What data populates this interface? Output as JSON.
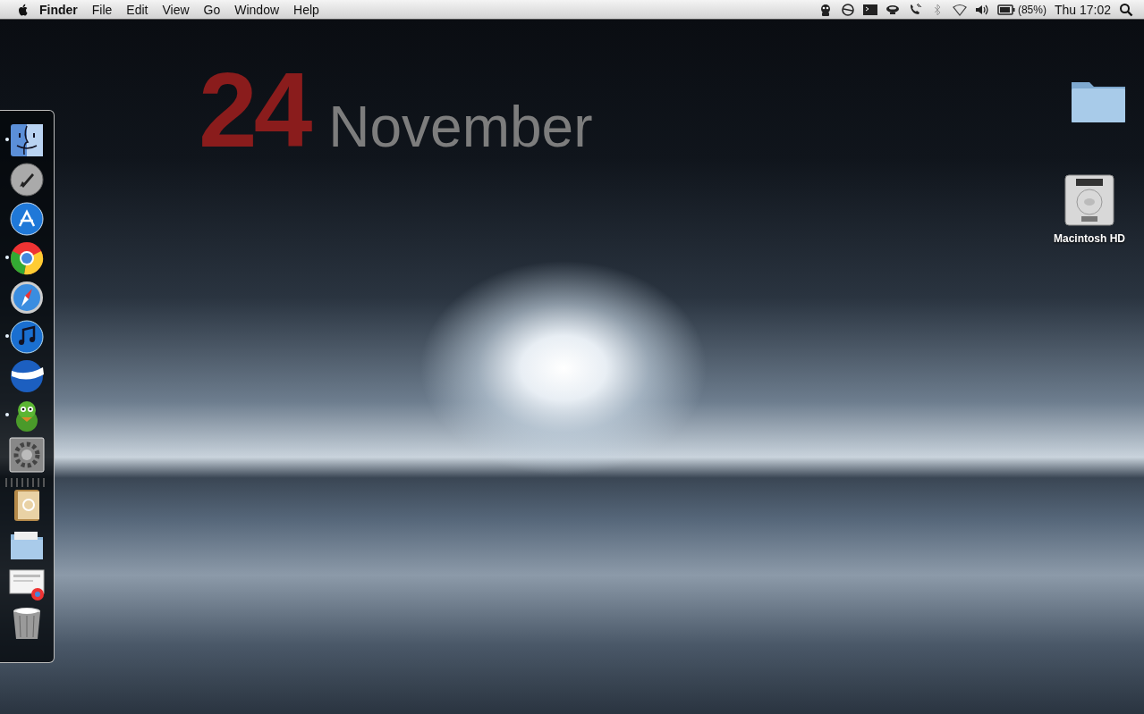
{
  "menu_bar": {
    "app_name": "Finder",
    "menus": [
      "File",
      "Edit",
      "View",
      "Go",
      "Window",
      "Help"
    ],
    "battery_percent": "(85%)",
    "clock": "Thu 17:02"
  },
  "date_widget": {
    "day": "24",
    "month": "November"
  },
  "desktop_icons": [
    {
      "kind": "folder"
    },
    {
      "kind": "drive",
      "label": "Macintosh HD"
    }
  ],
  "dock": {
    "items": [
      {
        "running": true
      },
      {
        "running": false
      },
      {
        "running": false
      },
      {
        "running": true
      },
      {
        "running": false
      },
      {
        "running": true
      },
      {
        "running": false
      },
      {
        "running": true
      },
      {
        "running": false
      },
      {
        "running": false
      },
      {
        "running": false
      },
      {
        "running": false
      },
      {
        "running": false
      }
    ]
  }
}
